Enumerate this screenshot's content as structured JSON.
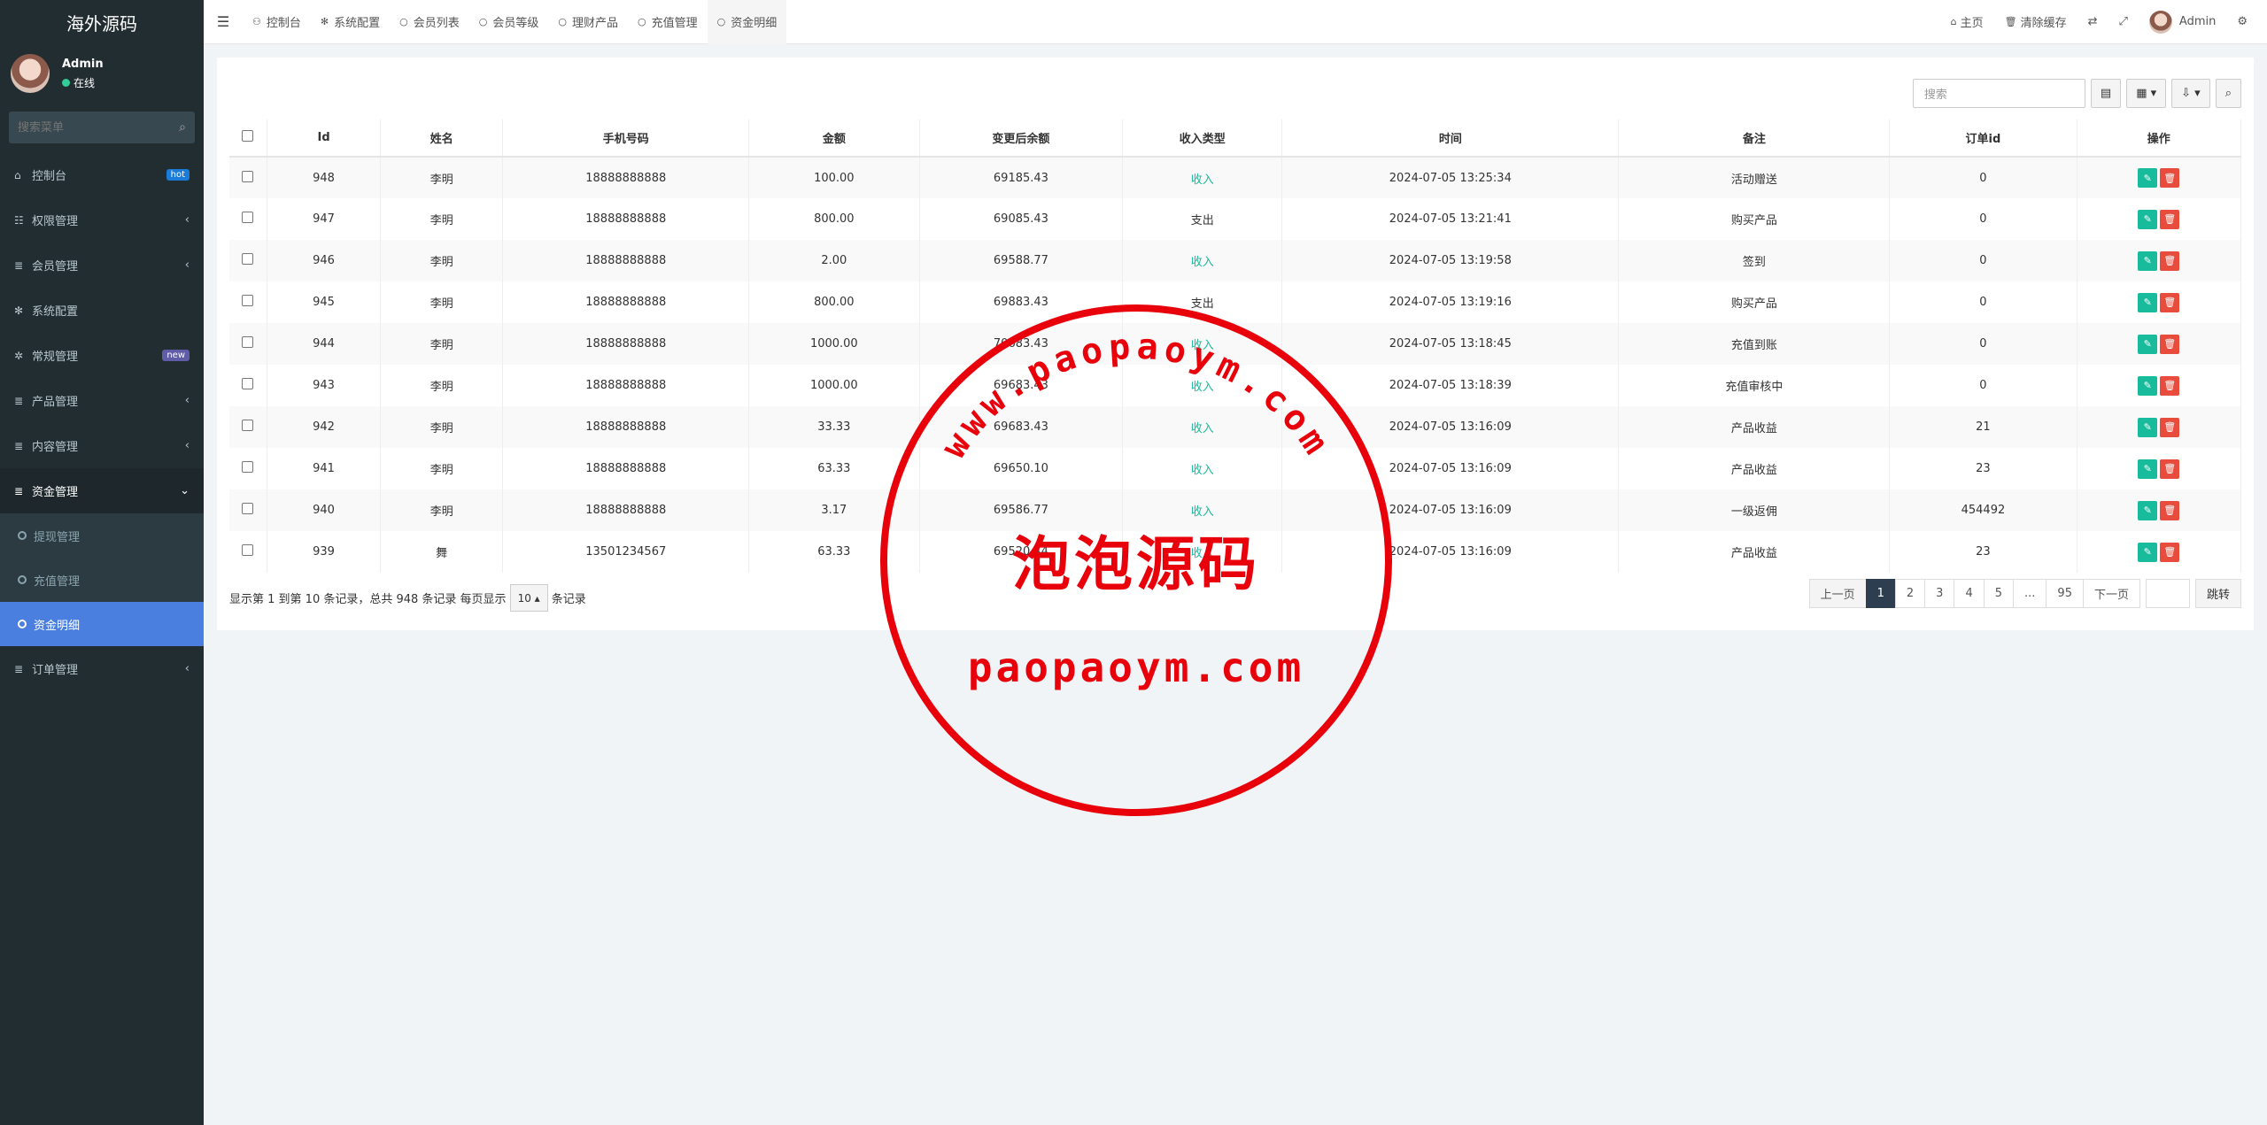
{
  "sidebar": {
    "logo": "海外源码",
    "user": {
      "name": "Admin",
      "status": "在线"
    },
    "search_placeholder": "搜索菜单",
    "menu": [
      {
        "icon": "dashboard-icon",
        "glyph": "⌂",
        "label": "控制台",
        "badge": "hot"
      },
      {
        "icon": "users-icon",
        "glyph": "☷",
        "label": "权限管理",
        "arrow": "‹"
      },
      {
        "icon": "list-icon",
        "glyph": "≣",
        "label": "会员管理",
        "arrow": "‹"
      },
      {
        "icon": "gear-icon",
        "glyph": "✻",
        "label": "系统配置"
      },
      {
        "icon": "cogs-icon",
        "glyph": "✲",
        "label": "常规管理",
        "badge": "new"
      },
      {
        "icon": "list-icon",
        "glyph": "≣",
        "label": "产品管理",
        "arrow": "‹"
      },
      {
        "icon": "list-icon",
        "glyph": "≣",
        "label": "内容管理",
        "arrow": "‹"
      },
      {
        "icon": "list-icon",
        "glyph": "≣",
        "label": "资金管理",
        "arrow": "⌄"
      }
    ],
    "submenu": [
      {
        "label": "提现管理"
      },
      {
        "label": "充值管理"
      },
      {
        "label": "资金明细"
      }
    ],
    "menu_after": {
      "glyph": "≣",
      "label": "订单管理",
      "arrow": "‹"
    }
  },
  "topbar": {
    "tabs": [
      "控制台",
      "系统配置",
      "会员列表",
      "会员等级",
      "理财产品",
      "充值管理",
      "资金明细"
    ],
    "home": "主页",
    "clear_cache": "清除缓存",
    "admin": "Admin"
  },
  "toolbar": {
    "search_placeholder": "搜索"
  },
  "table": {
    "headers": [
      "Id",
      "姓名",
      "手机号码",
      "金额",
      "变更后余额",
      "收入类型",
      "时间",
      "备注",
      "订单id",
      "操作"
    ],
    "rows": [
      [
        "948",
        "李明",
        "18888888888",
        "100.00",
        "69185.43",
        "收入",
        "2024-07-05 13:25:34",
        "活动赠送",
        "0"
      ],
      [
        "947",
        "李明",
        "18888888888",
        "800.00",
        "69085.43",
        "支出",
        "2024-07-05 13:21:41",
        "购买产品",
        "0"
      ],
      [
        "946",
        "李明",
        "18888888888",
        "2.00",
        "69588.77",
        "收入",
        "2024-07-05 13:19:58",
        "签到",
        "0"
      ],
      [
        "945",
        "李明",
        "18888888888",
        "800.00",
        "69883.43",
        "支出",
        "2024-07-05 13:19:16",
        "购买产品",
        "0"
      ],
      [
        "944",
        "李明",
        "18888888888",
        "1000.00",
        "70683.43",
        "收入",
        "2024-07-05 13:18:45",
        "充值到账",
        "0"
      ],
      [
        "943",
        "李明",
        "18888888888",
        "1000.00",
        "69683.43",
        "收入",
        "2024-07-05 13:18:39",
        "充值审核中",
        "0"
      ],
      [
        "942",
        "李明",
        "18888888888",
        "33.33",
        "69683.43",
        "收入",
        "2024-07-05 13:16:09",
        "产品收益",
        "21"
      ],
      [
        "941",
        "李明",
        "18888888888",
        "63.33",
        "69650.10",
        "收入",
        "2024-07-05 13:16:09",
        "产品收益",
        "23"
      ],
      [
        "940",
        "李明",
        "18888888888",
        "3.17",
        "69586.77",
        "收入",
        "2024-07-05 13:16:09",
        "一级返佣",
        "454492"
      ],
      [
        "939",
        "舞",
        "13501234567",
        "63.33",
        "69520.44",
        "收入",
        "2024-07-05 13:16:09",
        "产品收益",
        "23"
      ]
    ]
  },
  "footer": {
    "info_prefix": "显示第 1 到第 10 条记录，总共 948 条记录 每页显示",
    "page_size": "10",
    "info_suffix": "条记录"
  },
  "pager": {
    "prev": "上一页",
    "pages": [
      "1",
      "2",
      "3",
      "4",
      "5",
      "...",
      "95"
    ],
    "next": "下一页",
    "go": "跳转"
  },
  "stamp": {
    "arc_text": "www.paopaoym.com",
    "center_text": "泡泡源码",
    "bottom_text": "paopaoym.com",
    "color": "#e8000b"
  }
}
